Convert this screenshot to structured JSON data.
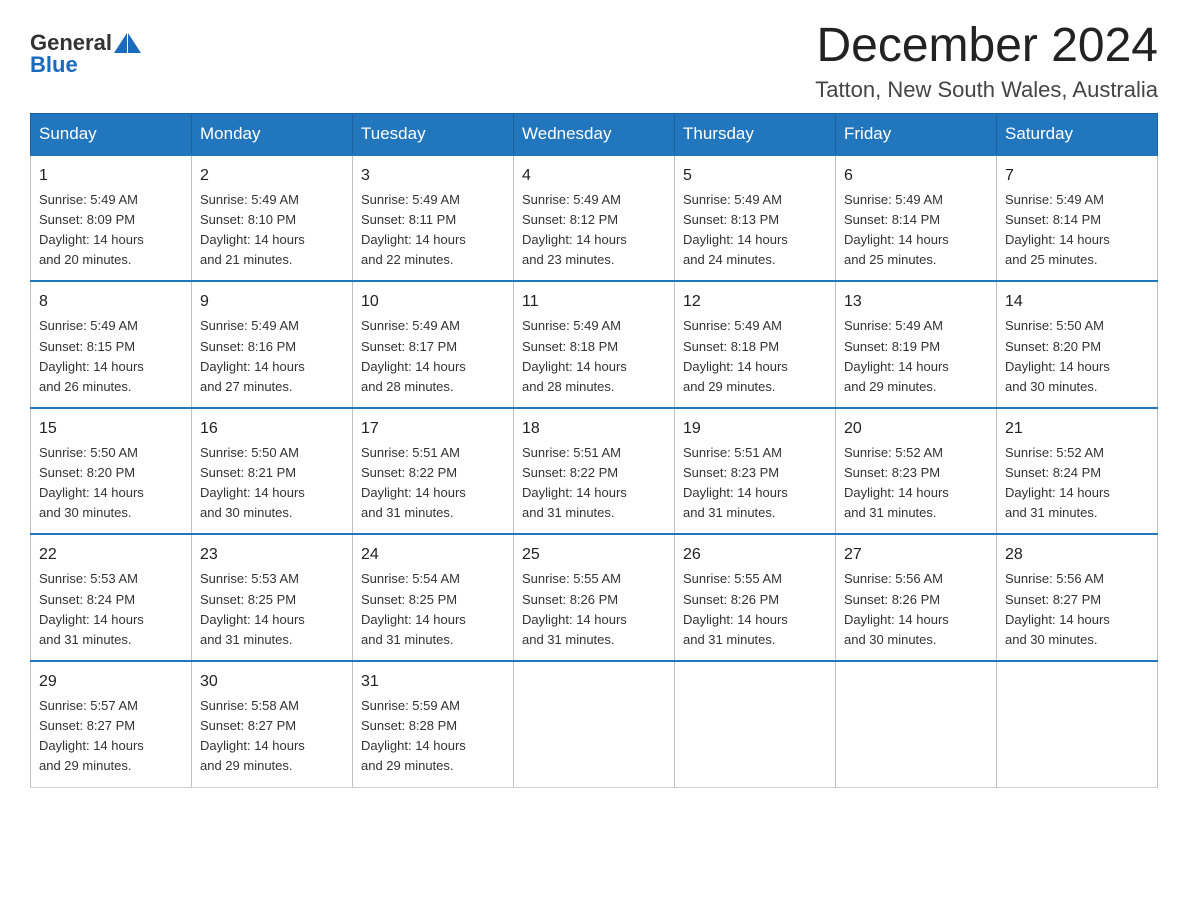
{
  "header": {
    "logo_general": "General",
    "logo_blue": "Blue",
    "title": "December 2024",
    "location": "Tatton, New South Wales, Australia"
  },
  "days_of_week": [
    "Sunday",
    "Monday",
    "Tuesday",
    "Wednesday",
    "Thursday",
    "Friday",
    "Saturday"
  ],
  "weeks": [
    [
      {
        "num": "1",
        "sunrise": "5:49 AM",
        "sunset": "8:09 PM",
        "daylight": "14 hours and 20 minutes."
      },
      {
        "num": "2",
        "sunrise": "5:49 AM",
        "sunset": "8:10 PM",
        "daylight": "14 hours and 21 minutes."
      },
      {
        "num": "3",
        "sunrise": "5:49 AM",
        "sunset": "8:11 PM",
        "daylight": "14 hours and 22 minutes."
      },
      {
        "num": "4",
        "sunrise": "5:49 AM",
        "sunset": "8:12 PM",
        "daylight": "14 hours and 23 minutes."
      },
      {
        "num": "5",
        "sunrise": "5:49 AM",
        "sunset": "8:13 PM",
        "daylight": "14 hours and 24 minutes."
      },
      {
        "num": "6",
        "sunrise": "5:49 AM",
        "sunset": "8:14 PM",
        "daylight": "14 hours and 25 minutes."
      },
      {
        "num": "7",
        "sunrise": "5:49 AM",
        "sunset": "8:14 PM",
        "daylight": "14 hours and 25 minutes."
      }
    ],
    [
      {
        "num": "8",
        "sunrise": "5:49 AM",
        "sunset": "8:15 PM",
        "daylight": "14 hours and 26 minutes."
      },
      {
        "num": "9",
        "sunrise": "5:49 AM",
        "sunset": "8:16 PM",
        "daylight": "14 hours and 27 minutes."
      },
      {
        "num": "10",
        "sunrise": "5:49 AM",
        "sunset": "8:17 PM",
        "daylight": "14 hours and 28 minutes."
      },
      {
        "num": "11",
        "sunrise": "5:49 AM",
        "sunset": "8:18 PM",
        "daylight": "14 hours and 28 minutes."
      },
      {
        "num": "12",
        "sunrise": "5:49 AM",
        "sunset": "8:18 PM",
        "daylight": "14 hours and 29 minutes."
      },
      {
        "num": "13",
        "sunrise": "5:49 AM",
        "sunset": "8:19 PM",
        "daylight": "14 hours and 29 minutes."
      },
      {
        "num": "14",
        "sunrise": "5:50 AM",
        "sunset": "8:20 PM",
        "daylight": "14 hours and 30 minutes."
      }
    ],
    [
      {
        "num": "15",
        "sunrise": "5:50 AM",
        "sunset": "8:20 PM",
        "daylight": "14 hours and 30 minutes."
      },
      {
        "num": "16",
        "sunrise": "5:50 AM",
        "sunset": "8:21 PM",
        "daylight": "14 hours and 30 minutes."
      },
      {
        "num": "17",
        "sunrise": "5:51 AM",
        "sunset": "8:22 PM",
        "daylight": "14 hours and 31 minutes."
      },
      {
        "num": "18",
        "sunrise": "5:51 AM",
        "sunset": "8:22 PM",
        "daylight": "14 hours and 31 minutes."
      },
      {
        "num": "19",
        "sunrise": "5:51 AM",
        "sunset": "8:23 PM",
        "daylight": "14 hours and 31 minutes."
      },
      {
        "num": "20",
        "sunrise": "5:52 AM",
        "sunset": "8:23 PM",
        "daylight": "14 hours and 31 minutes."
      },
      {
        "num": "21",
        "sunrise": "5:52 AM",
        "sunset": "8:24 PM",
        "daylight": "14 hours and 31 minutes."
      }
    ],
    [
      {
        "num": "22",
        "sunrise": "5:53 AM",
        "sunset": "8:24 PM",
        "daylight": "14 hours and 31 minutes."
      },
      {
        "num": "23",
        "sunrise": "5:53 AM",
        "sunset": "8:25 PM",
        "daylight": "14 hours and 31 minutes."
      },
      {
        "num": "24",
        "sunrise": "5:54 AM",
        "sunset": "8:25 PM",
        "daylight": "14 hours and 31 minutes."
      },
      {
        "num": "25",
        "sunrise": "5:55 AM",
        "sunset": "8:26 PM",
        "daylight": "14 hours and 31 minutes."
      },
      {
        "num": "26",
        "sunrise": "5:55 AM",
        "sunset": "8:26 PM",
        "daylight": "14 hours and 31 minutes."
      },
      {
        "num": "27",
        "sunrise": "5:56 AM",
        "sunset": "8:26 PM",
        "daylight": "14 hours and 30 minutes."
      },
      {
        "num": "28",
        "sunrise": "5:56 AM",
        "sunset": "8:27 PM",
        "daylight": "14 hours and 30 minutes."
      }
    ],
    [
      {
        "num": "29",
        "sunrise": "5:57 AM",
        "sunset": "8:27 PM",
        "daylight": "14 hours and 29 minutes."
      },
      {
        "num": "30",
        "sunrise": "5:58 AM",
        "sunset": "8:27 PM",
        "daylight": "14 hours and 29 minutes."
      },
      {
        "num": "31",
        "sunrise": "5:59 AM",
        "sunset": "8:28 PM",
        "daylight": "14 hours and 29 minutes."
      },
      null,
      null,
      null,
      null
    ]
  ],
  "labels": {
    "sunrise": "Sunrise:",
    "sunset": "Sunset:",
    "daylight": "Daylight:"
  }
}
